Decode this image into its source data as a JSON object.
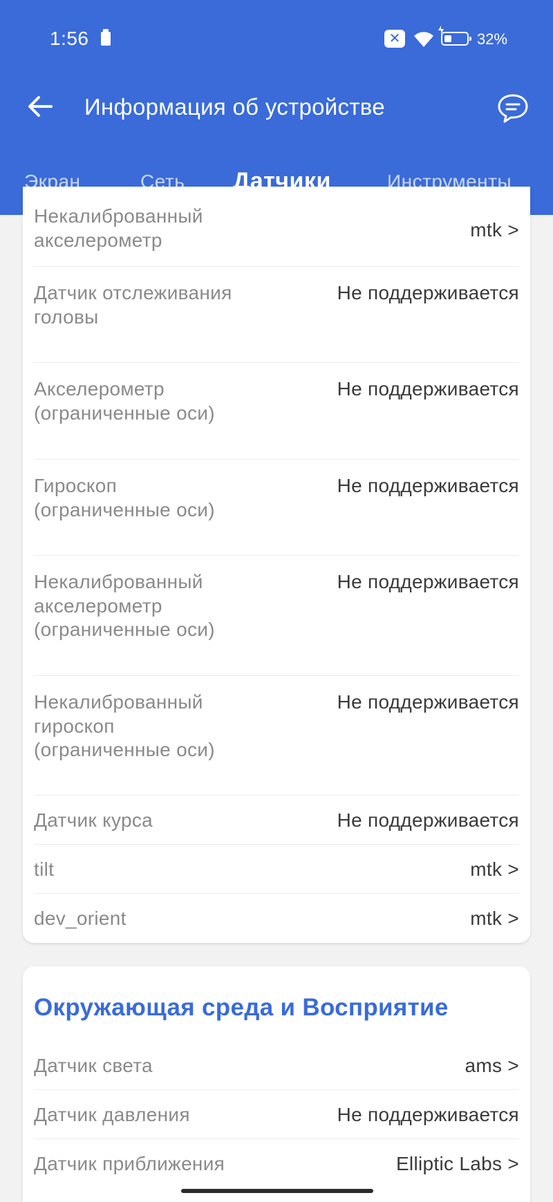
{
  "status_bar": {
    "time": "1:56",
    "battery_percent": "32%",
    "battery_level": 0.32,
    "icons": [
      "sim-card-icon",
      "no-sim-icon",
      "wifi-icon",
      "charging-icon",
      "battery-icon"
    ]
  },
  "app_bar": {
    "title": "Информация об устройстве",
    "back_icon": "arrow-left-icon",
    "feedback_icon": "chat-bubble-icon"
  },
  "tabs": [
    {
      "label": "Экран",
      "active": false
    },
    {
      "label": "Сеть",
      "active": false
    },
    {
      "label": "Датчики",
      "active": true
    },
    {
      "label": "Инструменты",
      "active": false
    }
  ],
  "sensors_card": {
    "rows": [
      {
        "label": "Некалиброванный акселерометр",
        "value": "mtk >"
      },
      {
        "label": "Датчик отслеживания головы",
        "value": "Не поддерживается"
      },
      {
        "label": "Акселерометр (ограниченные оси)",
        "value": "Не поддерживается"
      },
      {
        "label": "Гироскоп (ограниченные оси)",
        "value": "Не поддерживается"
      },
      {
        "label": "Некалиброванный акселерометр (ограниченные оси)",
        "value": "Не поддерживается"
      },
      {
        "label": "Некалиброванный гироскоп (ограниченные оси)",
        "value": "Не поддерживается"
      },
      {
        "label": "Датчик курса",
        "value": "Не поддерживается"
      },
      {
        "label": "tilt",
        "value": "mtk >"
      },
      {
        "label": "dev_orient",
        "value": "mtk >"
      }
    ]
  },
  "environment_card": {
    "title": "Окружающая среда и Восприятие",
    "rows": [
      {
        "label": "Датчик света",
        "value": "ams >"
      },
      {
        "label": "Датчик давления",
        "value": "Не поддерживается"
      },
      {
        "label": "Датчик приближения",
        "value": "Elliptic Labs >"
      }
    ]
  },
  "colors": {
    "primary": "#3a6bd9",
    "background": "#f2f2f2",
    "card": "#ffffff",
    "label_text": "#8a8a8a",
    "value_text": "#3a3a3a"
  }
}
